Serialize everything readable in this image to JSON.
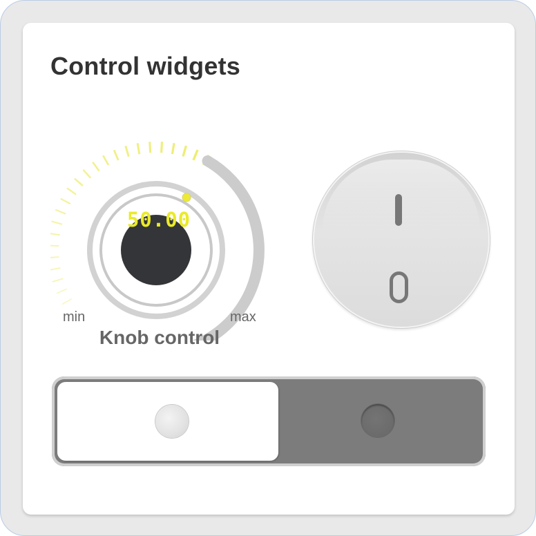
{
  "card": {
    "title": "Control widgets"
  },
  "knob": {
    "label": "Knob control",
    "value_display": "50.00",
    "value": 50,
    "min_label": "min",
    "max_label": "max",
    "accent_color": "#eded6e",
    "display_text_color": "#eaea2a",
    "indicator_color": "#ecea35"
  },
  "rocker_switch": {
    "on_symbol": "I",
    "off_symbol": "O",
    "icons": [
      "power-on-line-icon",
      "power-off-circle-icon"
    ]
  },
  "slide_toggle": {
    "state": "off",
    "track_color": "#7c7c7c"
  }
}
